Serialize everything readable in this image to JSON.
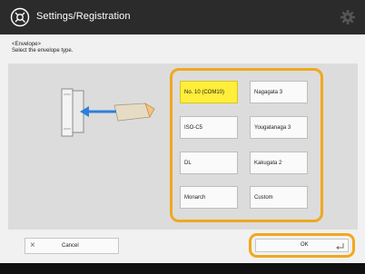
{
  "titlebar": {
    "title": "Settings/Registration",
    "app_icon": "settings-wrench-icon",
    "gear_icon": "gear-icon"
  },
  "instructions": {
    "line1": "<Envelope>",
    "line2": "Select the envelope type."
  },
  "envelope_options": [
    {
      "label": "No. 10 (COM10)",
      "selected": true
    },
    {
      "label": "Nagagata 3",
      "selected": false
    },
    {
      "label": "ISO-C5",
      "selected": false
    },
    {
      "label": "Yougatanaga 3",
      "selected": false
    },
    {
      "label": "DL",
      "selected": false
    },
    {
      "label": "Kakugata 2",
      "selected": false
    },
    {
      "label": "Monarch",
      "selected": false
    },
    {
      "label": "Custom",
      "selected": false
    }
  ],
  "footer": {
    "cancel_label": "Cancel",
    "ok_label": "OK"
  },
  "colors": {
    "selected": "#ffee3a",
    "highlight_frame": "#f0a81e",
    "titlebar": "#2b2b2b"
  }
}
